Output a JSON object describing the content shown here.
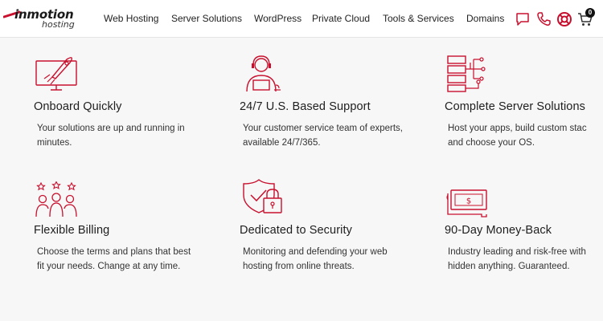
{
  "brand": {
    "name": "inmotion",
    "sub": "hosting",
    "accent": "#c8102e"
  },
  "nav": {
    "items": [
      "Web Hosting",
      "Server Solutions",
      "WordPress",
      "Private Cloud",
      "Tools & Services",
      "Domains"
    ],
    "cart_count": "0"
  },
  "header_icons": [
    "chat-icon",
    "phone-icon",
    "support-lifebuoy-icon",
    "cart-icon"
  ],
  "features": [
    {
      "icon": "rocket-monitor-icon",
      "title": "Onboard Quickly",
      "desc": [
        "Your solutions are up and running in",
        "minutes."
      ]
    },
    {
      "icon": "support-agent-icon",
      "title": "24/7 U.S. Based Support",
      "desc": [
        "Your customer service team of experts,",
        "available 24/7/365."
      ]
    },
    {
      "icon": "server-network-icon",
      "title": "Complete Server Solutions",
      "desc": [
        "Host your apps, build custom stac",
        "and choose your OS."
      ]
    },
    {
      "icon": "people-stars-icon",
      "title": "Flexible Billing",
      "desc": [
        "Choose the terms and plans that best",
        "fit your needs. Change at any time."
      ]
    },
    {
      "icon": "shield-lock-icon",
      "title": "Dedicated to Security",
      "desc": [
        "Monitoring and defending your web",
        "hosting from online threats."
      ]
    },
    {
      "icon": "money-bill-icon",
      "title": "90-Day Money-Back",
      "desc": [
        "Industry leading and risk-free with",
        "hidden anything. Guaranteed."
      ]
    }
  ]
}
